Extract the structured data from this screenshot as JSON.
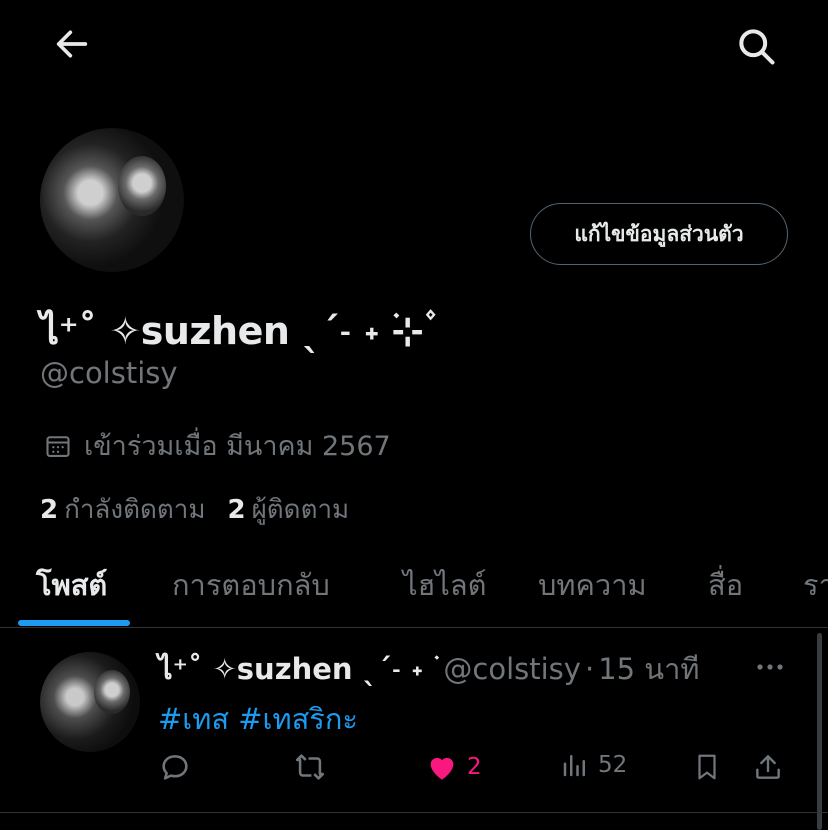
{
  "header": {
    "back_icon": "arrow-left-icon",
    "search_icon": "search-icon"
  },
  "profile": {
    "display_name": "ไ⁺˚ ✧suzhen ˎˊ˗ ˖ ࣪⊹ ۫",
    "handle": "@colstisy",
    "edit_button_label": "แก้ไขข้อมูลส่วนตัว",
    "joined_text": "เข้าร่วมเมื่อ มีนาคม 2567",
    "following_count": "2",
    "following_label": "กำลังติดตาม",
    "followers_count": "2",
    "followers_label": "ผู้ติดตาม"
  },
  "tabs": [
    {
      "label": "โพสต์",
      "active": true
    },
    {
      "label": "การตอบกลับ",
      "active": false
    },
    {
      "label": "ไฮไลต์",
      "active": false
    },
    {
      "label": "บทความ",
      "active": false
    },
    {
      "label": "สื่อ",
      "active": false
    },
    {
      "label": "รา",
      "active": false
    }
  ],
  "post": {
    "author_name": "ไ⁺˚ ✧suzhen ˎˊ˗ ˖ ࣪",
    "author_handle": "@colstisy",
    "separator": "·",
    "time": "15 นาที",
    "text": "#เทส #เทสริกะ",
    "like_count": "2",
    "view_count": "52"
  },
  "colors": {
    "accent": "#1d9bf0",
    "like": "#f91880",
    "muted": "#71767b"
  }
}
